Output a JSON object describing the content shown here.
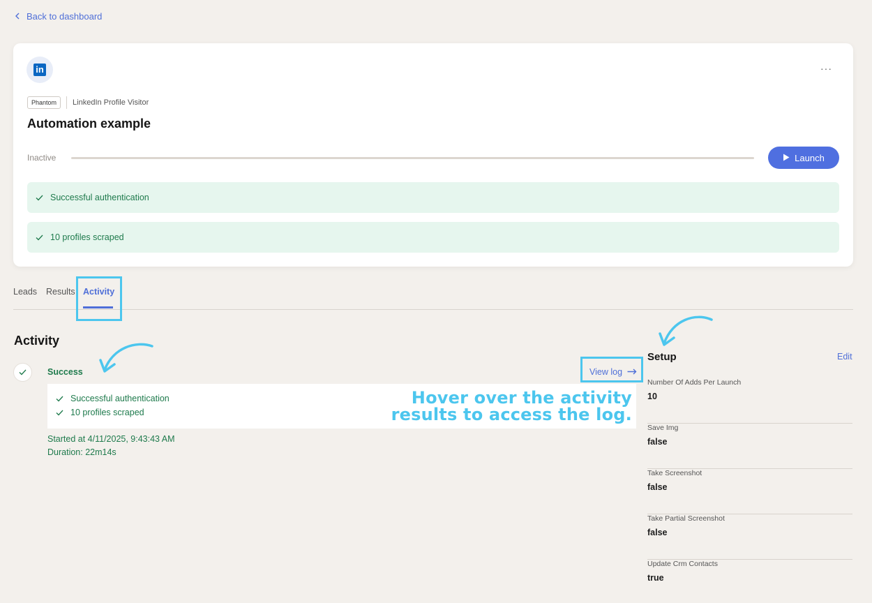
{
  "nav": {
    "back_label": "Back to dashboard"
  },
  "card": {
    "logo_letters": "in",
    "more_label": "···",
    "badge": "Phantom",
    "type_label": "LinkedIn Profile Visitor",
    "title": "Automation example",
    "status": "Inactive",
    "launch_label": "Launch",
    "messages": [
      "Successful authentication",
      "10 profiles scraped"
    ]
  },
  "tabs": [
    "Leads",
    "Results",
    "Activity"
  ],
  "activity": {
    "title": "Activity",
    "status": "Success",
    "view_log": "View log",
    "results": [
      "Successful authentication",
      "10 profiles scraped"
    ],
    "started": "Started at 4/11/2025, 9:43:43 AM",
    "duration": "Duration: 22m14s"
  },
  "annotation": {
    "line1": "Hover over the activity",
    "line2": "results to access the log."
  },
  "setup": {
    "title": "Setup",
    "edit": "Edit",
    "items": [
      {
        "label": "Number Of Adds Per Launch",
        "value": "10"
      },
      {
        "label": "Save Img",
        "value": "false"
      },
      {
        "label": "Take Screenshot",
        "value": "false"
      },
      {
        "label": "Take Partial Screenshot",
        "value": "false"
      },
      {
        "label": "Update Crm Contacts",
        "value": "true"
      }
    ]
  },
  "colors": {
    "accent": "#4f6fd8",
    "success": "#1e7a4c",
    "highlight": "#4cc6ee",
    "background": "#f3f0ec"
  }
}
